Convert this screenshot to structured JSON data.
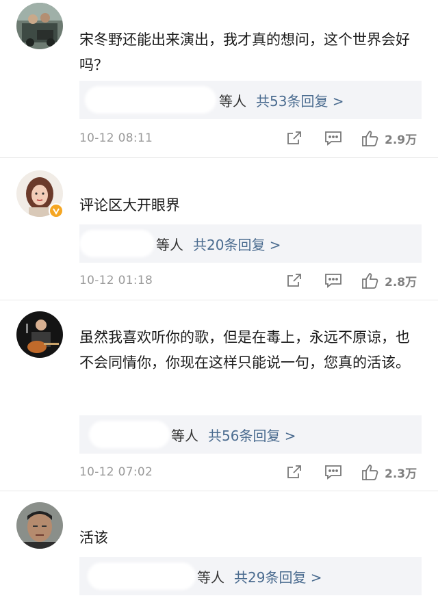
{
  "comments": [
    {
      "text": "宋冬野还能出来演出，我才真的想问，这个世界会好吗？",
      "reply_prefix": "等人",
      "reply_count": "共53条回复 >",
      "time": "10-12 08:11",
      "likes": "2.9万"
    },
    {
      "text": "评论区大开眼界",
      "reply_prefix": "等人",
      "reply_count": "共20条回复 >",
      "time": "10-12 01:18",
      "likes": "2.8万"
    },
    {
      "text": "虽然我喜欢听你的歌，但是在毒上，永远不原谅，也不会同情你，你现在这样只能说一句，您真的活该。",
      "reply_prefix": "等人",
      "reply_count": "共56条回复 >",
      "time": "10-12 07:02",
      "likes": "2.3万"
    },
    {
      "text": "活该",
      "reply_prefix": "等人",
      "reply_count": "共29条回复 >"
    }
  ],
  "icons": {
    "share": "share-icon",
    "comment": "comment-icon",
    "like": "thumbs-up-icon",
    "verified": "verified-badge-icon"
  },
  "colors": {
    "link": "#4a6b8f",
    "meta": "#9a9a9a",
    "reply_bg": "#f3f4f7",
    "verified": "#f5a623"
  }
}
